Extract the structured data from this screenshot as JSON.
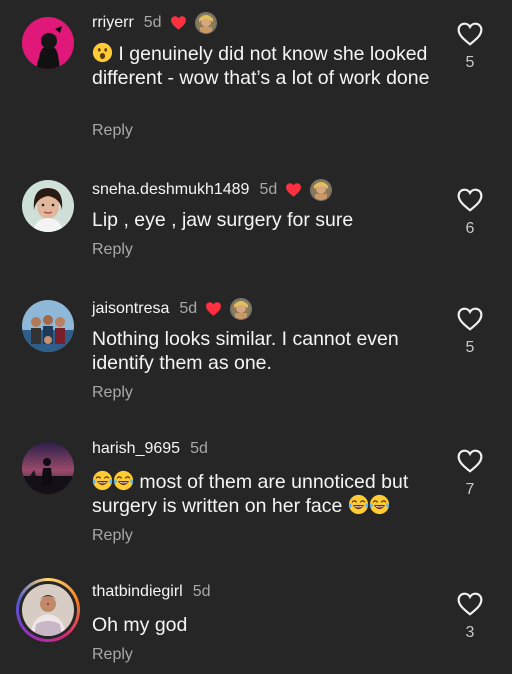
{
  "comments": [
    {
      "username": "rriyerr",
      "time": "5d",
      "text": "I genuinely did not know she looked different - wow that’s a lot of work done",
      "reply": "Reply",
      "likes": "5",
      "creator_liked": true,
      "emoji_prefix": "surprised-face"
    },
    {
      "username": "sneha.deshmukh1489",
      "time": "5d",
      "text": "Lip , eye , jaw surgery for sure",
      "reply": "Reply",
      "likes": "6",
      "creator_liked": true
    },
    {
      "username": "jaisontresa",
      "time": "5d",
      "text": "Nothing looks similar. I cannot even identify them as one.",
      "reply": "Reply",
      "likes": "5",
      "creator_liked": true
    },
    {
      "username": "harish_9695",
      "time": "5d",
      "text_part1": "most of them are unnoticed but surgery is written on her face",
      "reply": "Reply",
      "likes": "7",
      "creator_liked": false,
      "emoji": "laughing-tears"
    },
    {
      "username": "thatbindiegirl",
      "time": "5d",
      "text": "Oh my god",
      "reply": "Reply",
      "likes": "3",
      "creator_liked": false
    }
  ],
  "colors": {
    "background": "#262626",
    "liked_heart": "#ff3040",
    "secondary_text": "#a8a8a8"
  }
}
